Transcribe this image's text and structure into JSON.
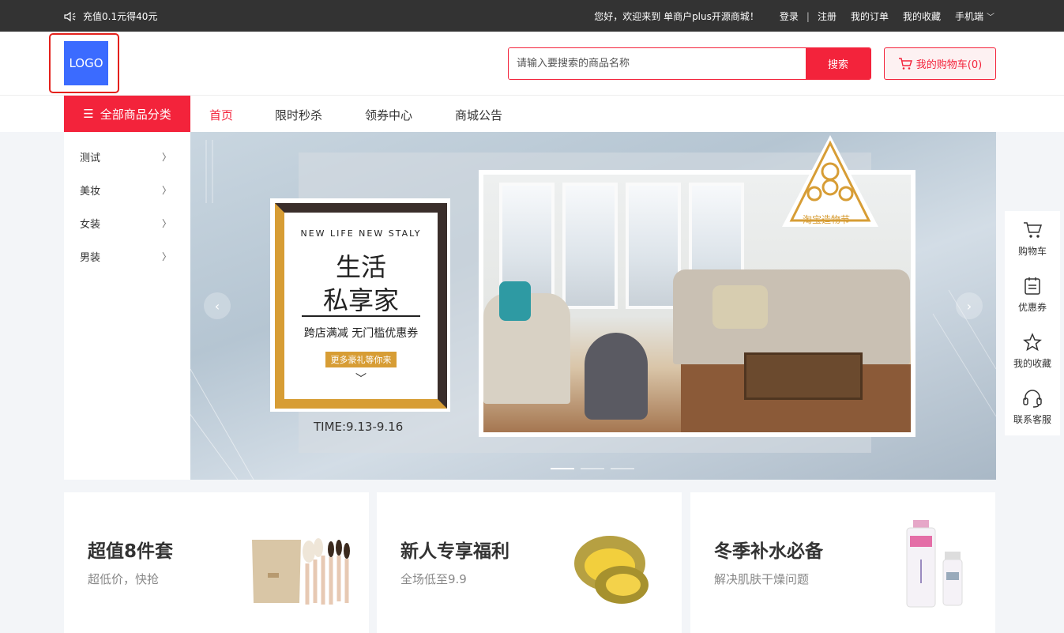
{
  "topbar": {
    "notice": "充值0.1元得40元",
    "welcome": "您好，欢迎来到 单商户plus开源商城！",
    "login": "登录",
    "separator": "|",
    "register": "注册",
    "my_orders": "我的订单",
    "my_favorites": "我的收藏",
    "mobile": "手机端"
  },
  "header": {
    "logo_text": "LOGO",
    "search_placeholder": "请输入要搜索的商品名称",
    "search_button": "搜索",
    "cart_label": "我的购物车(0)"
  },
  "nav": {
    "all_categories": "全部商品分类",
    "items": [
      "首页",
      "限时秒杀",
      "领券中心",
      "商城公告"
    ]
  },
  "categories": [
    "测试",
    "美妆",
    "女装",
    "男装"
  ],
  "banner": {
    "en_title": "NEW LIFE NEW STALY",
    "title_line1": "生活",
    "title_line2": "私享家",
    "subtitle": "跨店满减 无门槛优惠券",
    "button": "更多豪礼等你来",
    "time": "TIME:9.13-9.16",
    "festival": "淘宝造物节",
    "slide_count": 3,
    "active_slide": 1
  },
  "float_bar": {
    "items": [
      {
        "label": "购物车",
        "icon": "cart-icon"
      },
      {
        "label": "优惠券",
        "icon": "coupon-icon"
      },
      {
        "label": "我的收藏",
        "icon": "star-icon"
      },
      {
        "label": "联系客服",
        "icon": "headset-icon"
      }
    ]
  },
  "promos": [
    {
      "title": "超值8件套",
      "subtitle": "超低价，快抢"
    },
    {
      "title": "新人专享福利",
      "subtitle": "全场低至9.9"
    },
    {
      "title": "冬季补水必备",
      "subtitle": "解决肌肤干燥问题"
    }
  ],
  "colors": {
    "accent": "#f3233b",
    "topbar": "#333333",
    "logo": "#3b6bff",
    "gold": "#d79d35"
  }
}
